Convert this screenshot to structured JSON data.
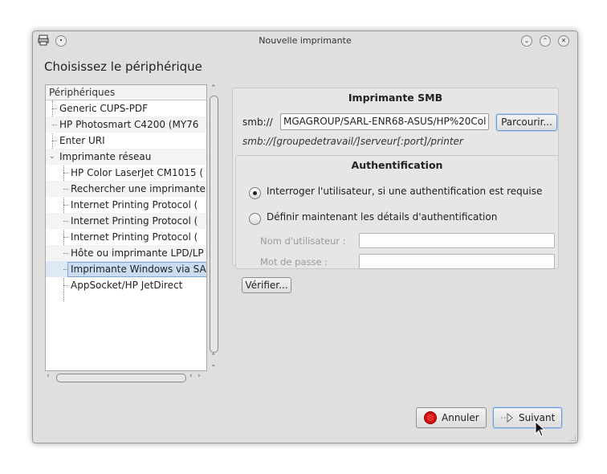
{
  "window": {
    "title": "Nouvelle imprimante",
    "heading": "Choisissez le périphérique"
  },
  "tree": {
    "header": "Périphériques",
    "items": [
      {
        "label": "Generic CUPS-PDF"
      },
      {
        "label": "HP Photosmart C4200 (MY76"
      },
      {
        "label": "Enter URI"
      },
      {
        "label": "Imprimante réseau"
      },
      {
        "label": "HP Color LaserJet CM1015 ("
      },
      {
        "label": "Rechercher une imprimante"
      },
      {
        "label": "Internet Printing Protocol ("
      },
      {
        "label": "Internet Printing Protocol ("
      },
      {
        "label": "Internet Printing Protocol ("
      },
      {
        "label": "Hôte ou imprimante LPD/LP"
      },
      {
        "label": "Imprimante Windows via SA"
      },
      {
        "label": "AppSocket/HP JetDirect"
      }
    ],
    "selected": "Imprimante Windows via SA"
  },
  "smb": {
    "group_title": "Imprimante SMB",
    "prefix_label": "smb://",
    "url_value": "MGAGROUP/SARL-ENR68-ASUS/HP%20Col",
    "browse_label": "Parcourir...",
    "hint": "smb://[groupedetravail/]serveur[:port]/printer"
  },
  "auth": {
    "group_title": "Authentification",
    "option_prompt": "Interroger l'utilisateur, si une authentification est requise",
    "option_define": "Définir maintenant les détails d'authentification",
    "selected_option": "prompt",
    "username_label": "Nom d'utilisateur :",
    "password_label": "Mot de passe :",
    "username_value": "",
    "password_value": ""
  },
  "buttons": {
    "verify": "Vérifier...",
    "cancel": "Annuler",
    "next": "Suivant"
  },
  "icons": {
    "window": "printer-icon",
    "cancel": "stop-icon",
    "next": "arrow-right-icon"
  }
}
